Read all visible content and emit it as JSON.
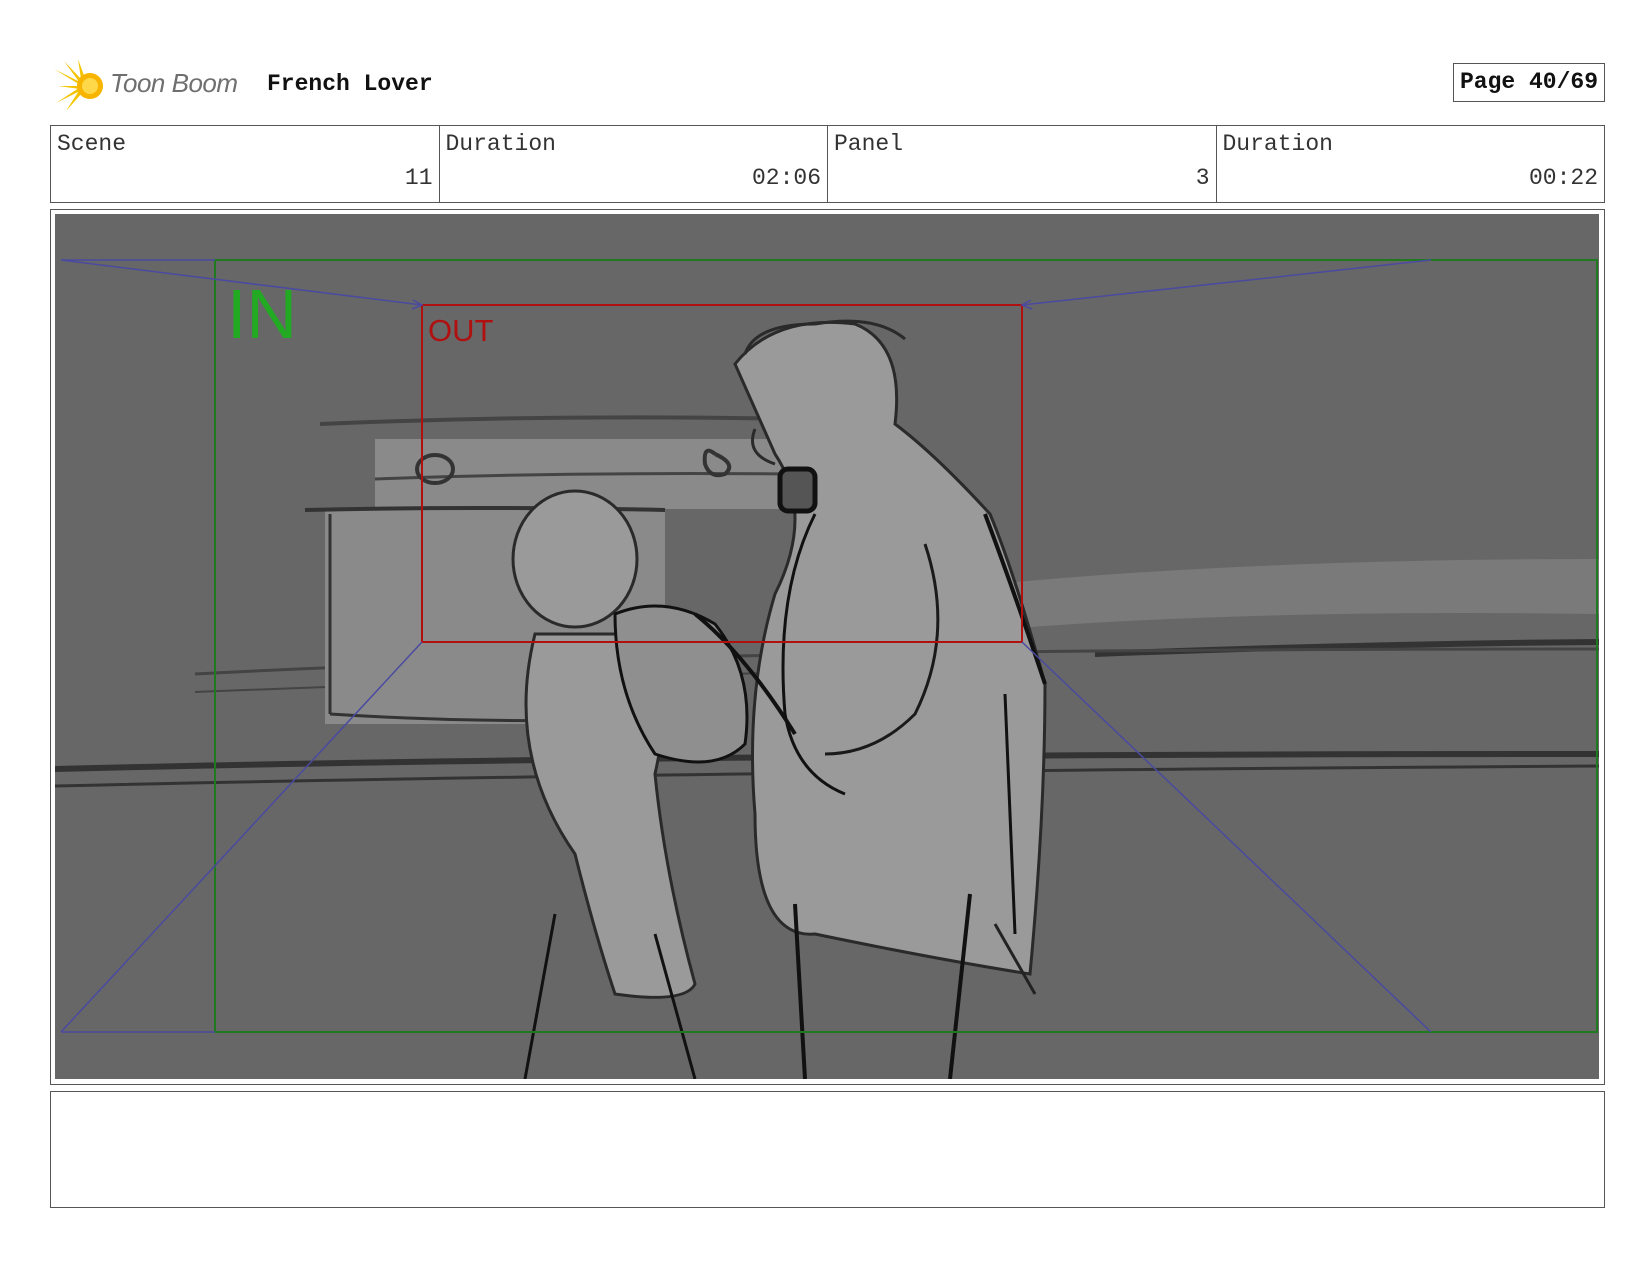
{
  "header": {
    "logo_text": "Toon Boom",
    "project_title": "French Lover",
    "page_label": "Page 40/69"
  },
  "info": {
    "scene_label": "Scene",
    "scene_value": "11",
    "scene_duration_label": "Duration",
    "scene_duration_value": "02:06",
    "panel_label": "Panel",
    "panel_value": "3",
    "panel_duration_label": "Duration",
    "panel_duration_value": "00:22"
  },
  "panel": {
    "in_label": "IN",
    "out_label": "OUT",
    "in_color": "#1f7a1f",
    "in_text_color": "#22aa22",
    "out_color": "#b01010",
    "guide_color": "#4a4aa0"
  },
  "notes": {
    "text": ""
  }
}
